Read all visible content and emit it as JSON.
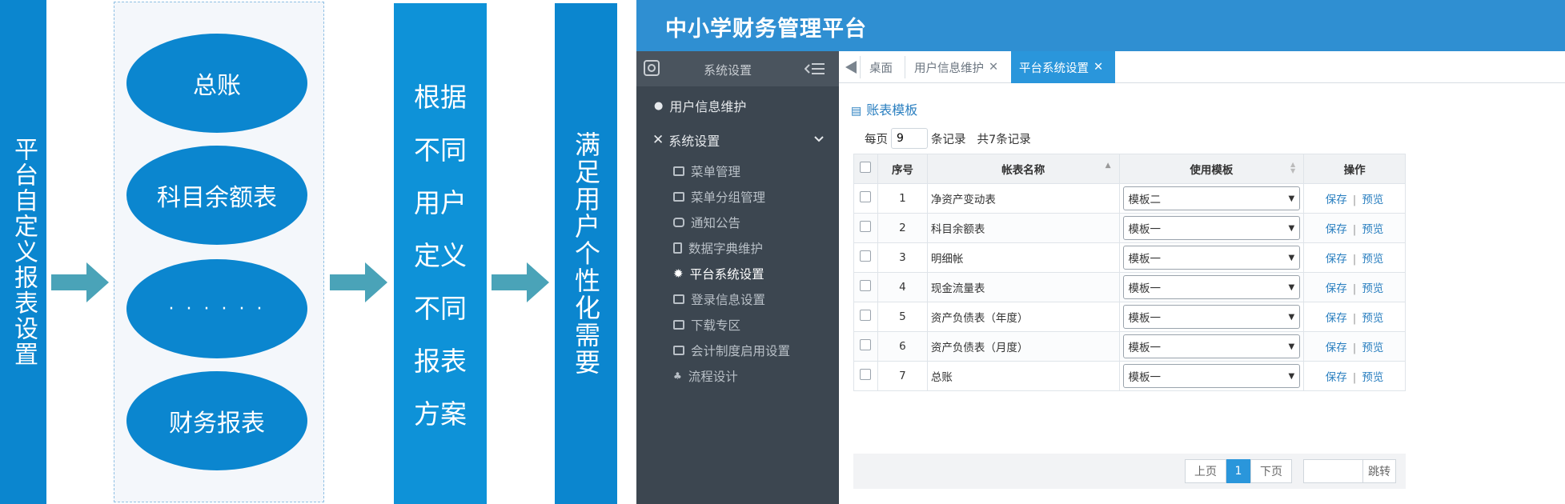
{
  "diagram": {
    "left_bar": "平台自定义报表设置",
    "items": [
      "总账",
      "科目余额表",
      "· · · · · ·",
      "财务报表"
    ],
    "middle_bar_lines": [
      "根据",
      "不同",
      "用户",
      "定义",
      "不同",
      "报表",
      "方案"
    ],
    "right_bar": "满足用户个性化需要"
  },
  "app": {
    "title": "中小学财务管理平台",
    "sidebar": {
      "header": "系统设置",
      "items": [
        {
          "label": "用户信息维护",
          "icon": "user-icon"
        },
        {
          "label": "系统设置",
          "icon": "tools-icon"
        }
      ],
      "sub_items": [
        {
          "label": "菜单管理",
          "icon": "menu-icon"
        },
        {
          "label": "菜单分组管理",
          "icon": "menu-group-icon"
        },
        {
          "label": "通知公告",
          "icon": "notice-icon"
        },
        {
          "label": "数据字典维护",
          "icon": "book-icon"
        },
        {
          "label": "平台系统设置",
          "icon": "gear-icon"
        },
        {
          "label": "登录信息设置",
          "icon": "login-icon"
        },
        {
          "label": "下载专区",
          "icon": "download-icon"
        },
        {
          "label": "会计制度启用设置",
          "icon": "accounting-icon"
        },
        {
          "label": "流程设计",
          "icon": "workflow-icon"
        }
      ]
    },
    "tabs": [
      {
        "label": "桌面"
      },
      {
        "label": "用户信息维护"
      },
      {
        "label": "平台系统设置"
      }
    ],
    "section_title": "账表模板",
    "pager": {
      "prefix": "每页",
      "per_page": "9",
      "suffix": "条记录",
      "total": "共7条记录"
    },
    "table": {
      "headers": [
        "序号",
        "帐表名称",
        "使用模板",
        "操作"
      ],
      "rows": [
        {
          "no": "1",
          "name": "净资产变动表",
          "template": "模板二"
        },
        {
          "no": "2",
          "name": "科目余额表",
          "template": "模板一"
        },
        {
          "no": "3",
          "name": "明细帐",
          "template": "模板一"
        },
        {
          "no": "4",
          "name": "现金流量表",
          "template": "模板一"
        },
        {
          "no": "5",
          "name": "资产负债表（年度）",
          "template": "模板一"
        },
        {
          "no": "6",
          "name": "资产负债表（月度）",
          "template": "模板一"
        },
        {
          "no": "7",
          "name": "总账",
          "template": "模板一"
        }
      ],
      "save_label": "保存",
      "preview_label": "预览"
    },
    "footer": {
      "prev": "上页",
      "current": "1",
      "next": "下页",
      "jump": "跳转"
    }
  },
  "colors": {
    "primary": "#0b86cf",
    "header": "#2f8fd2",
    "sidebar": "#3c4650",
    "arrow": "#4aa3b8"
  }
}
